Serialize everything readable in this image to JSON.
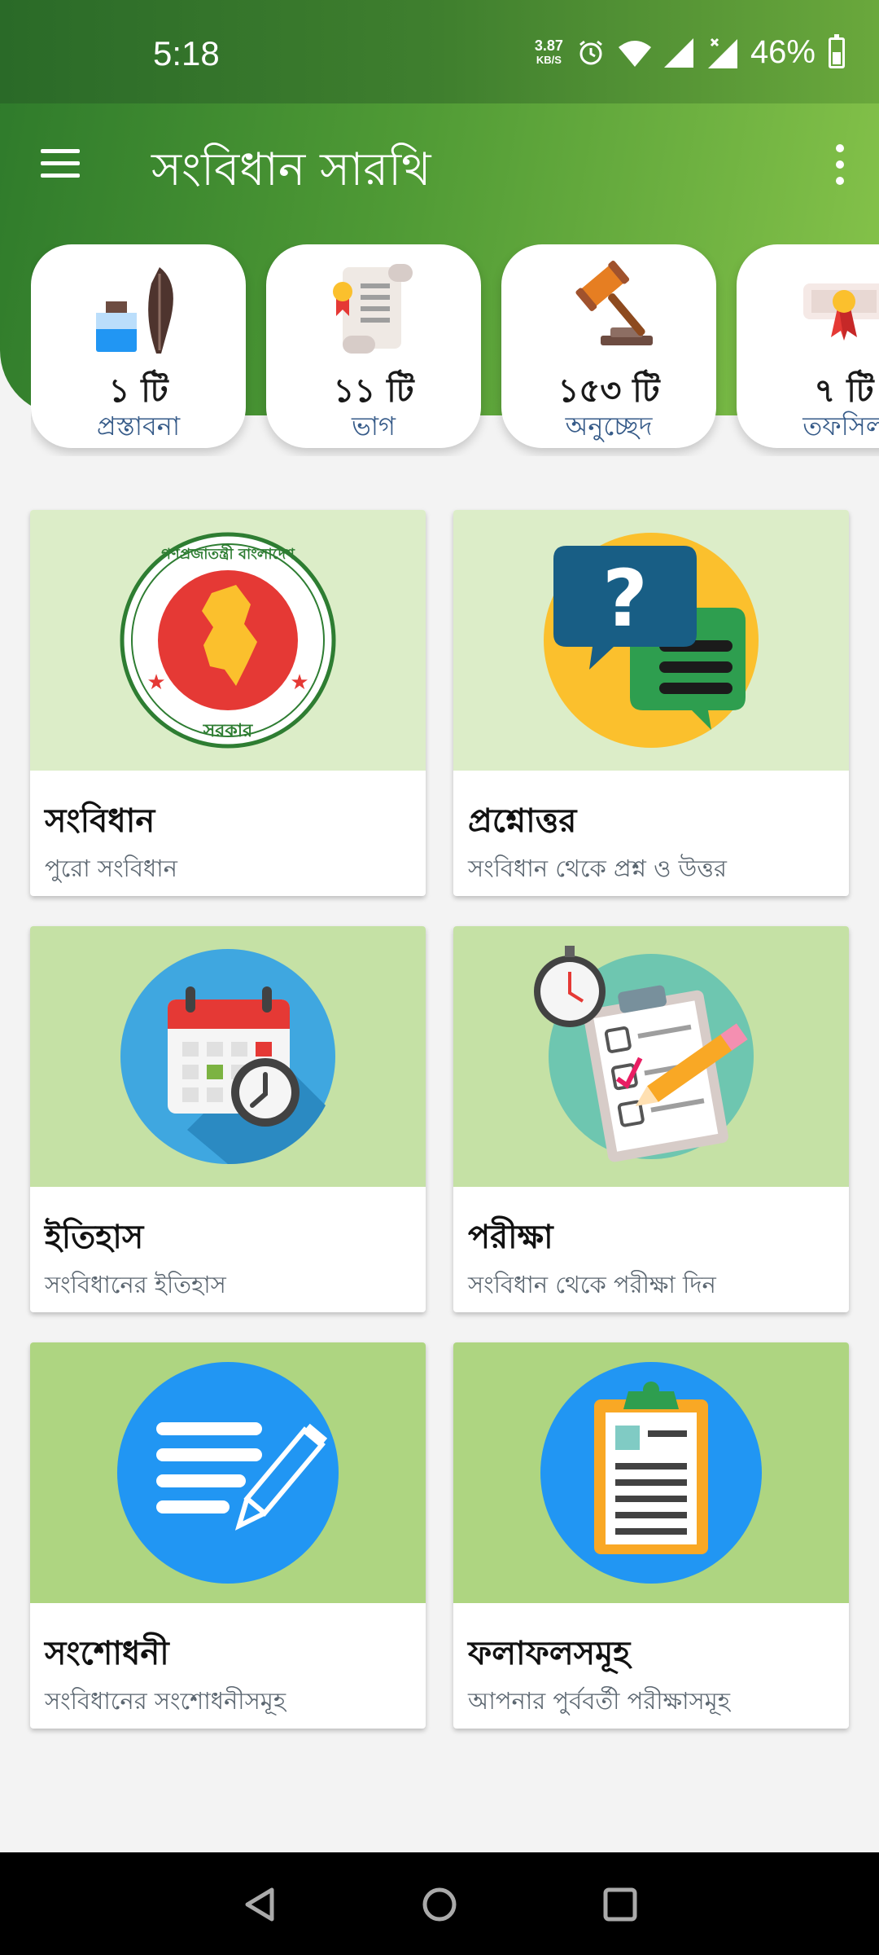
{
  "status_bar": {
    "time": "5:18",
    "net_speed_value": "3.87",
    "net_speed_unit": "KB/S",
    "battery_percent": "46%"
  },
  "toolbar": {
    "title": "সংবিধান সারথি"
  },
  "stats": [
    {
      "count": "১ টি",
      "label": "প্রস্তাবনা",
      "icon": "ink-quill-icon"
    },
    {
      "count": "১১ টি",
      "label": "ভাগ",
      "icon": "scroll-icon"
    },
    {
      "count": "১৫৩ টি",
      "label": "অনুচ্ছেদ",
      "icon": "gavel-icon"
    },
    {
      "count": "৭ টি",
      "label": "তফসিল",
      "icon": "diploma-icon"
    }
  ],
  "cards": [
    {
      "title": "সংবিধান",
      "subtitle": "পুরো সংবিধান",
      "icon": "government-seal-icon",
      "bg": "#dcedc8"
    },
    {
      "title": "প্রশ্নোত্তর",
      "subtitle": "সংবিধান থেকে প্রশ্ন ও উত্তর",
      "icon": "question-chat-icon",
      "bg": "#dcedc8"
    },
    {
      "title": "ইতিহাস",
      "subtitle": "সংবিধানের ইতিহাস",
      "icon": "calendar-clock-icon",
      "bg": "#c5e1a5"
    },
    {
      "title": "পরীক্ষা",
      "subtitle": "সংবিধান থেকে পরীক্ষা দিন",
      "icon": "exam-clipboard-icon",
      "bg": "#c5e1a5"
    },
    {
      "title": "সংশোধনী",
      "subtitle": "সংবিধানের সংশোধনীসমূহ",
      "icon": "edit-document-icon",
      "bg": "#aed581"
    },
    {
      "title": "ফলাফলসমূহ",
      "subtitle": "আপনার পুর্ববর্তী পরীক্ষাসমূহ",
      "icon": "results-clipboard-icon",
      "bg": "#aed581"
    }
  ],
  "seal_text": {
    "top": "গণপ্রজাতন্ত্রী বাংলাদেশ",
    "bottom": "সরকার"
  },
  "colors": {
    "header_dark": "#2e7a2b",
    "header_light": "#86c34a",
    "label_blue": "#355a88"
  }
}
